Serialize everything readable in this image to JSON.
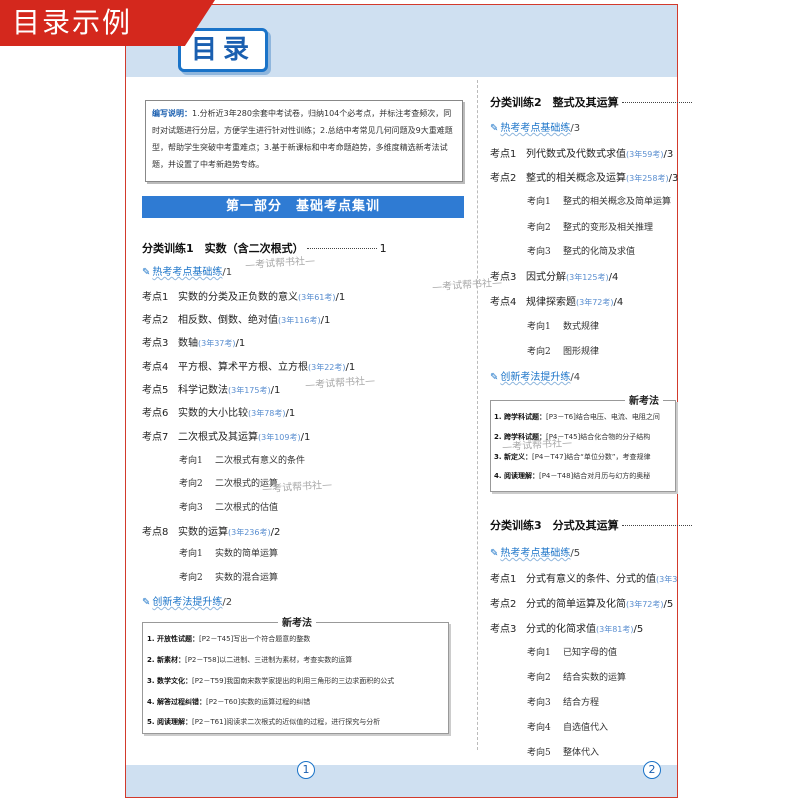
{
  "tag": "目录示例",
  "page_title": "目录",
  "note": {
    "label": "编写说明：",
    "text": "1.分析近3年280余套中考试卷，归纳104个必考点，并标注考查频次，同时对试题进行分层，方便学生进行针对性训练；2.总结中考常见几何问题及9大重难题型，帮助学生突破中考重难点；3.基于新课标和中考命题趋势，多维度精选新考法试题，并设置了中考新趋势专练。"
  },
  "part_title": "第一部分　基础考点集训",
  "left": {
    "sec1": {
      "title": "分类训练1　实数（含二次根式）",
      "page": "1"
    },
    "hot": {
      "label": "热考考点基础练",
      "page": "/1"
    },
    "points": [
      {
        "num": "考点1",
        "title": "实数的分类及正负数的意义",
        "count": "(3年61考)",
        "page": "/1"
      },
      {
        "num": "考点2",
        "title": "相反数、倒数、绝对值",
        "count": "(3年116考)",
        "page": "/1"
      },
      {
        "num": "考点3",
        "title": "数轴",
        "count": "(3年37考)",
        "page": "/1"
      },
      {
        "num": "考点4",
        "title": "平方根、算术平方根、立方根",
        "count": "(3年22考)",
        "page": "/1"
      },
      {
        "num": "考点5",
        "title": "科学记数法",
        "count": "(3年175考)",
        "page": "/1"
      },
      {
        "num": "考点6",
        "title": "实数的大小比较",
        "count": "(3年78考)",
        "page": "/1"
      },
      {
        "num": "考点7",
        "title": "二次根式及其运算",
        "count": "(3年109考)",
        "page": "/1"
      }
    ],
    "kp7_subs": [
      {
        "label": "考向1",
        "text": "二次根式有意义的条件"
      },
      {
        "label": "考向2",
        "text": "二次根式的运算"
      },
      {
        "label": "考向3",
        "text": "二次根式的估值"
      }
    ],
    "kp8": {
      "num": "考点8",
      "title": "实数的运算",
      "count": "(3年236考)",
      "page": "/2"
    },
    "kp8_subs": [
      {
        "label": "考向1",
        "text": "实数的简单运算"
      },
      {
        "label": "考向2",
        "text": "实数的混合运算"
      }
    ],
    "innov": {
      "label": "创新考法提升练",
      "page": "/2"
    },
    "new_box": {
      "title": "新考法",
      "lines": [
        {
          "k": "1. 开放性试题：",
          "v": "[P2－T45]写出一个符合题意的整数"
        },
        {
          "k": "2. 新素材：",
          "v": "[P2－T58]以二进制、三进制为素材，考查实数的运算"
        },
        {
          "k": "3. 数学文化：",
          "v": "[P2－T59]我国南宋数学家提出的利用三角形的三边求面积的公式"
        },
        {
          "k": "4. 解答过程纠错：",
          "v": "[P2－T60]实数的运算过程的纠错"
        },
        {
          "k": "5. 阅读理解：",
          "v": "[P2－T61]阅读求二次根式的近似值的过程，进行探究与分析"
        }
      ]
    }
  },
  "right": {
    "sec2": {
      "title": "分类训练2　整式及其运算"
    },
    "hot2": {
      "label": "热考考点基础练",
      "page": "/3"
    },
    "points2": [
      {
        "num": "考点1",
        "title": "列代数式及代数式求值",
        "count": "(3年59考)",
        "page": "/3"
      },
      {
        "num": "考点2",
        "title": "整式的相关概念及运算",
        "count": "(3年258考)",
        "page": "/3"
      }
    ],
    "kp2_subs": [
      {
        "label": "考向1",
        "text": "整式的相关概念及简单运算"
      },
      {
        "label": "考向2",
        "text": "整式的变形及相关推理"
      },
      {
        "label": "考向3",
        "text": "整式的化简及求值"
      }
    ],
    "points2b": [
      {
        "num": "考点3",
        "title": "因式分解",
        "count": "(3年125考)",
        "page": "/4"
      },
      {
        "num": "考点4",
        "title": "规律探索题",
        "count": "(3年72考)",
        "page": "/4"
      }
    ],
    "kp4_subs": [
      {
        "label": "考向1",
        "text": "数式规律"
      },
      {
        "label": "考向2",
        "text": "图形规律"
      }
    ],
    "innov2": {
      "label": "创新考法提升练",
      "page": "/4"
    },
    "new_box2": {
      "title": "新考法",
      "lines": [
        {
          "k": "1. 跨学科试题：",
          "v": "[P3－T6]结合电压、电流、电阻之间"
        },
        {
          "k": "2. 跨学科试题：",
          "v": "[P4－T45]结合化合物的分子结构"
        },
        {
          "k": "3. 新定义：",
          "v": "[P4－T47]结合“单位分数”，考查规律"
        },
        {
          "k": "4. 阅读理解：",
          "v": "[P4－T48]结合对月历与幻方的奥秘"
        }
      ]
    },
    "sec3": {
      "title": "分类训练3　分式及其运算"
    },
    "hot3": {
      "label": "热考考点基础练",
      "page": "/5"
    },
    "points3": [
      {
        "num": "考点1",
        "title": "分式有意义的条件、分式的值",
        "count": "(3年3",
        "page": ""
      },
      {
        "num": "考点2",
        "title": "分式的简单运算及化简",
        "count": "(3年72考)",
        "page": "/5"
      },
      {
        "num": "考点3",
        "title": "分式的化简求值",
        "count": "(3年81考)",
        "page": "/5"
      }
    ],
    "kp3_subs": [
      {
        "label": "考向1",
        "text": "已知字母的值"
      },
      {
        "label": "考向2",
        "text": "结合实数的运算"
      },
      {
        "label": "考向3",
        "text": "结合方程"
      },
      {
        "label": "考向4",
        "text": "自选值代入"
      },
      {
        "label": "考向5",
        "text": "整体代入"
      }
    ]
  },
  "watermark": "考试帮书社",
  "pages": {
    "left": "1",
    "right": "2"
  },
  "colors": {
    "accent": "#1a73c8",
    "tag": "#d4281d",
    "band": "#cfe0f1"
  }
}
